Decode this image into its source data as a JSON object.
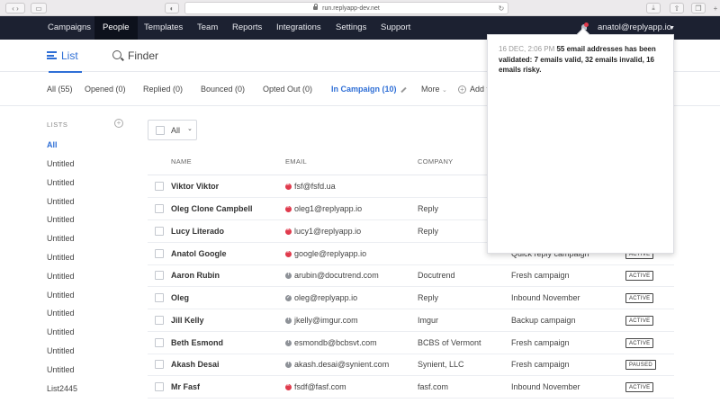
{
  "browser": {
    "url": "run.replyapp-dev.net"
  },
  "nav": {
    "items": [
      "Campaigns",
      "People",
      "Templates",
      "Team",
      "Reports",
      "Integrations",
      "Settings",
      "Support"
    ],
    "active_index": 1,
    "user": "anatol@replyapp.io"
  },
  "subtabs": {
    "list": "List",
    "finder": "Finder"
  },
  "filters": {
    "all": "All (55)",
    "opened": "Opened (0)",
    "replied": "Replied (0)",
    "bounced": "Bounced (0)",
    "opted_out": "Opted Out (0)",
    "in_campaign": "In Campaign (10)",
    "more": "More",
    "add": "Add f"
  },
  "sidebar": {
    "heading": "LISTS",
    "items": [
      "All",
      "Untitled",
      "Untitled",
      "Untitled",
      "Untitled",
      "Untitled",
      "Untitled",
      "Untitled",
      "Untitled",
      "Untitled",
      "Untitled",
      "Untitled",
      "Untitled",
      "List2445"
    ]
  },
  "table": {
    "select_label": "All",
    "headers": {
      "name": "NAME",
      "email": "EMAIL",
      "company": "COMPANY"
    },
    "rows": [
      {
        "name": "Viktor Viktor",
        "email": "fsf@fsfd.ua",
        "email_status": "invalid",
        "company": "",
        "campaign": "",
        "status": ""
      },
      {
        "name": "Oleg Clone Campbell",
        "email": "oleg1@replyapp.io",
        "email_status": "invalid",
        "company": "Reply",
        "campaign": "",
        "status": ""
      },
      {
        "name": "Lucy Literado",
        "email": "lucy1@replyapp.io",
        "email_status": "invalid",
        "company": "Reply",
        "campaign": "",
        "status": ""
      },
      {
        "name": "Anatol Google",
        "email": "google@replyapp.io",
        "email_status": "invalid",
        "company": "",
        "campaign": "Quick reply campaign",
        "status": "ACTIVE"
      },
      {
        "name": "Aaron Rubin",
        "email": "arubin@docutrend.com",
        "email_status": "risky",
        "company": "Docutrend",
        "campaign": "Fresh campaign",
        "status": "ACTIVE"
      },
      {
        "name": "Oleg",
        "email": "oleg@replyapp.io",
        "email_status": "valid",
        "company": "Reply",
        "campaign": "Inbound November",
        "status": "ACTIVE"
      },
      {
        "name": "Jill Kelly",
        "email": "jkelly@imgur.com",
        "email_status": "risky",
        "company": "Imgur",
        "campaign": "Backup campaign",
        "status": "ACTIVE"
      },
      {
        "name": "Beth Esmond",
        "email": "esmondb@bcbsvt.com",
        "email_status": "risky",
        "company": "BCBS of Vermont",
        "campaign": "Fresh campaign",
        "status": "ACTIVE"
      },
      {
        "name": "Akash Desai",
        "email": "akash.desai@synient.com",
        "email_status": "risky",
        "company": "Synient, LLC",
        "campaign": "Fresh campaign",
        "status": "PAUSED"
      },
      {
        "name": "Mr Fasf",
        "email": "fsdf@fasf.com",
        "email_status": "invalid",
        "company": "fasf.com",
        "campaign": "Inbound November",
        "status": "ACTIVE"
      }
    ]
  },
  "notification": {
    "time": "16 DEC, 2:06 PM",
    "message": "55 email addresses has been validated: 7 emails valid, 32 emails invalid, 16 emails risky."
  },
  "colors": {
    "nav_bg": "#1c2131",
    "accent": "#2f6fd6",
    "invalid": "#e03b4d"
  }
}
